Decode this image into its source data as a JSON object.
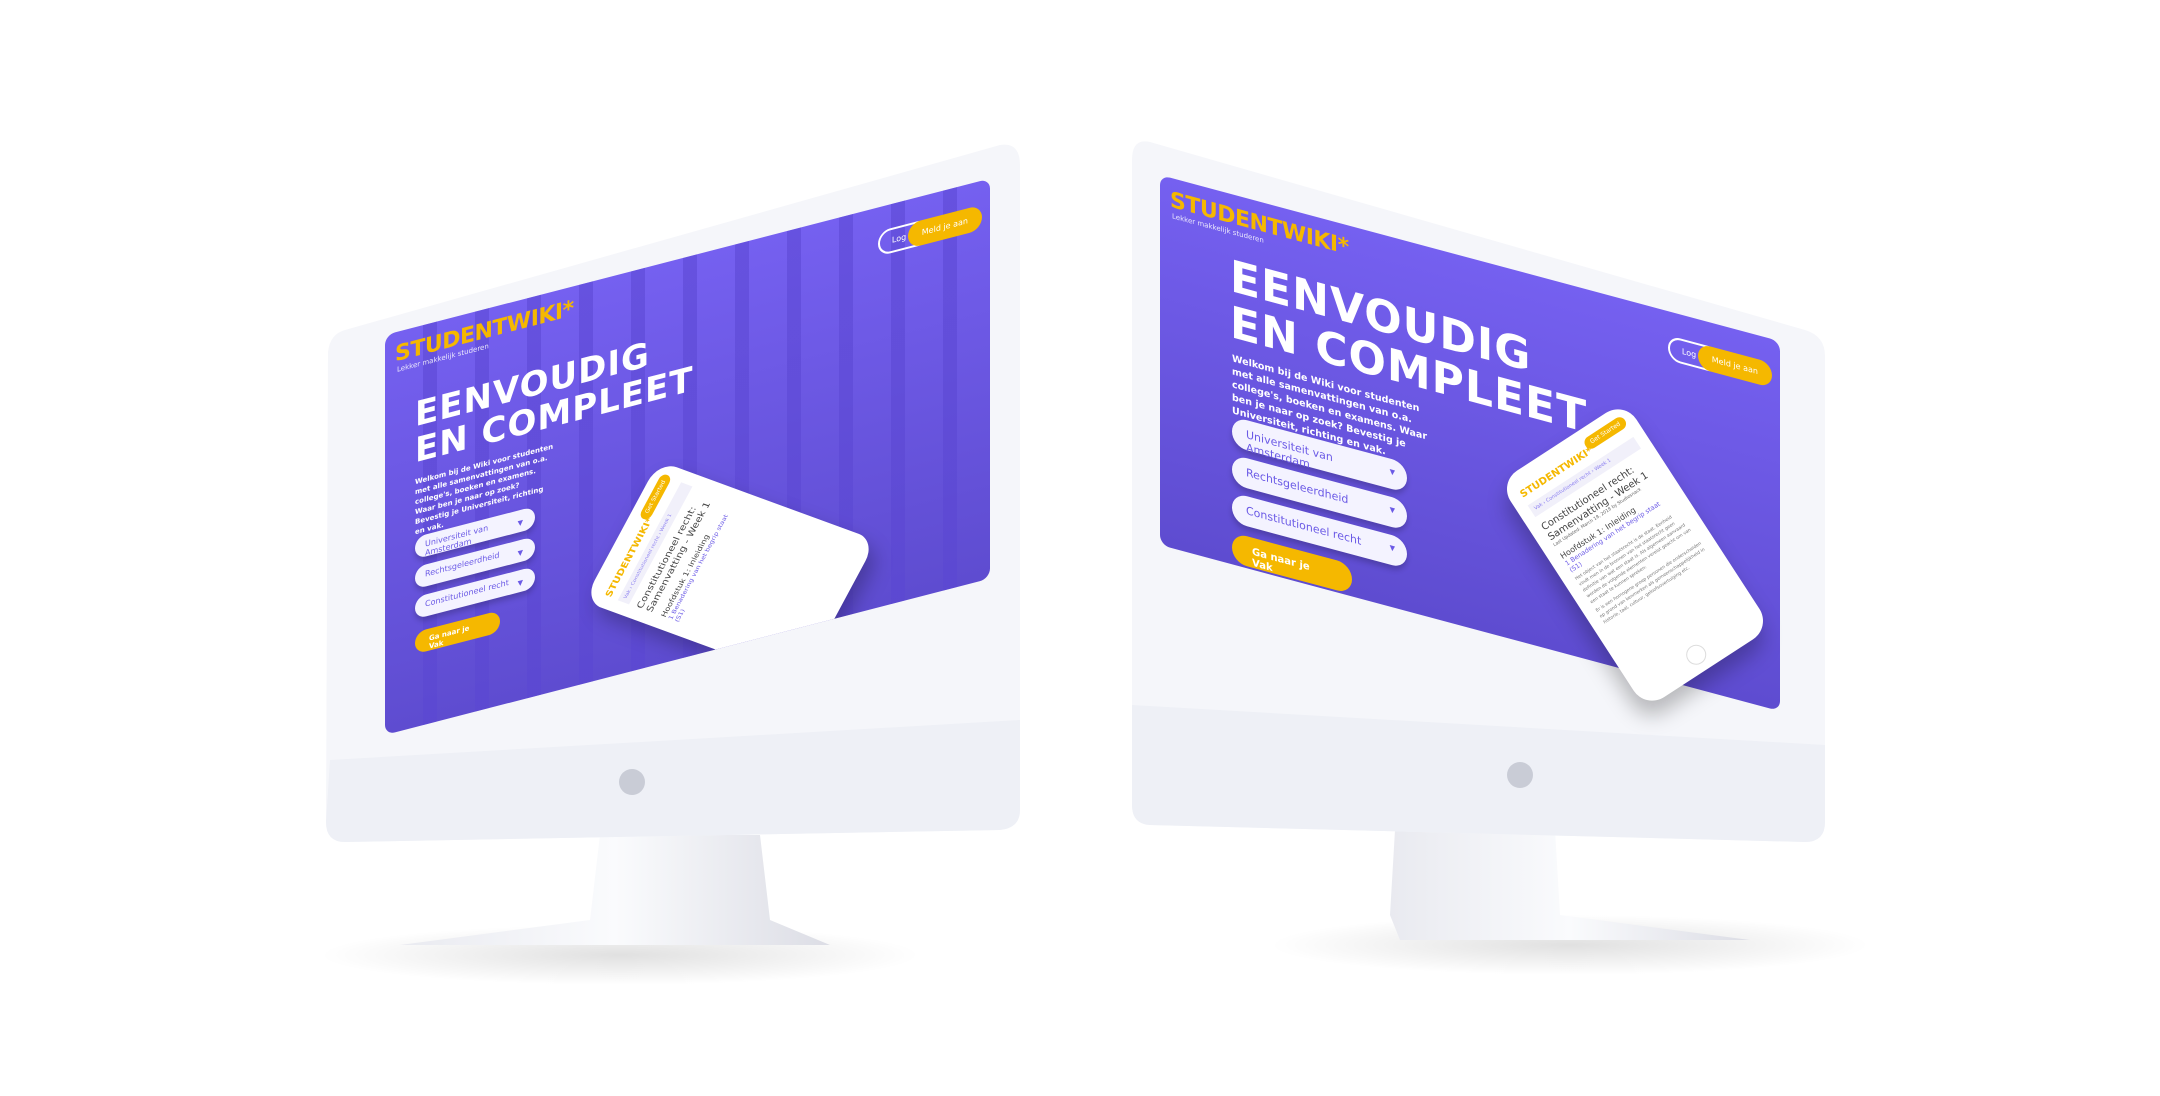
{
  "site": {
    "logo": "STUDENTWIKI*",
    "tagline": "Lekker makkelijk studeren",
    "login_label": "Log in",
    "signup_label": "Meld je aan",
    "headline_line1": "EENVOUDIG",
    "headline_line2": "EN COMPLEET",
    "intro": "Welkom bij de Wiki voor studenten met alle samenvattingen van o.a. college's, boeken en examens. Waar ben je naar op zoek? Bevestig je Universiteit, richting en vak.",
    "dropdowns": [
      "Universiteit van Amsterdam",
      "Rechtsgeleerdheid",
      "Constitutioneel recht"
    ],
    "cta_label": "Ga naar je Vak"
  },
  "phone": {
    "logo": "STUDENTWIKI*",
    "get_started": "Get Started",
    "breadcrumb": "Vak › Constitutioneel recht › Week 1",
    "title": "Constitutioneel recht: Samenvatting - Week 1",
    "last_updated": "Last Updated: March 18, 2018 by Studiesnack",
    "chapter": "Hoofdstuk 1: Inleiding",
    "section_link": "1 Benadering van het begrip staat (S1)",
    "body": "Het object van het staatsrecht is de staat. Eenheid vindt men in de bronnen van het staatsrecht geen definitie van wat een staat is. Als algemeen aanvaard worden de volgende elementen vereist geacht om van een staat te kunnen spreken:",
    "bullet": "Er is een homogene groep personen die onderscheiden op grond van kenmerken als gemeenschappelijkheid in historie, taal, cultuur, geloofsovertuiging etc."
  },
  "colors": {
    "brand_purple": "#6f5ce8",
    "brand_yellow": "#f5b800"
  }
}
